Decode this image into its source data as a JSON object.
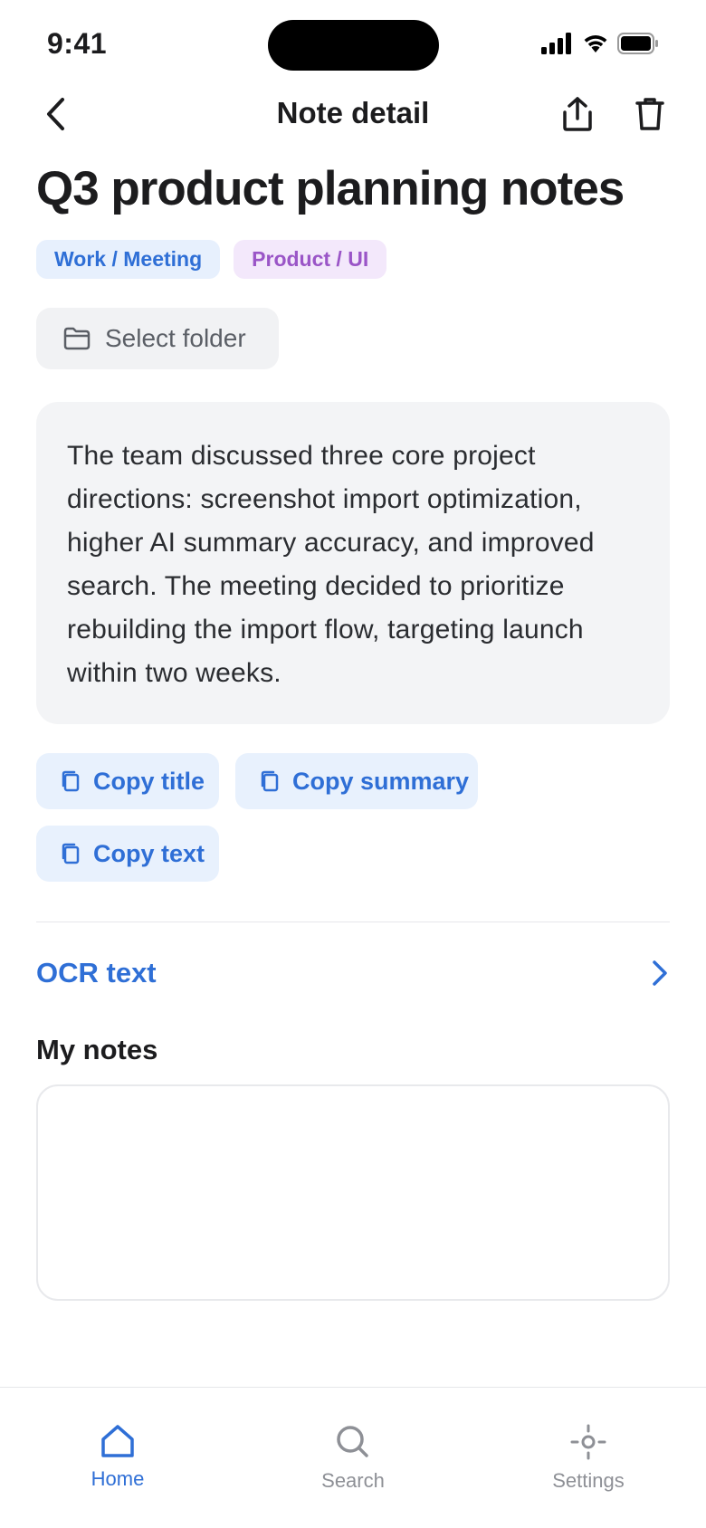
{
  "status_bar": {
    "time": "9:41"
  },
  "nav": {
    "title": "Note detail"
  },
  "note": {
    "title": "Q3 product planning notes",
    "tags": [
      "Work / Meeting",
      "Product / UI"
    ],
    "folder_label": "Select folder",
    "summary": "The team discussed three core project directions: screenshot import optimization, higher AI summary accuracy, and improved search. The meeting decided to prioritize rebuilding the import flow, targeting launch within two weeks."
  },
  "actions": {
    "copy_title": "Copy title",
    "copy_summary": "Copy summary",
    "copy_text": "Copy text"
  },
  "ocr": {
    "label": "OCR text"
  },
  "my_notes": {
    "heading": "My notes",
    "value": ""
  },
  "tabbar": {
    "home": "Home",
    "search": "Search",
    "settings": "Settings"
  },
  "colors": {
    "accent": "#2f6fd6",
    "tag_blue_bg": "#e7f0fd",
    "tag_purple_bg": "#f3e8fb",
    "tag_purple_text": "#9a55c7",
    "card_bg": "#f3f4f6"
  },
  "icons": [
    "back-chevron-icon",
    "share-icon",
    "trash-icon",
    "folder-icon",
    "copy-icon",
    "chevron-right-icon",
    "home-icon",
    "search-icon",
    "settings-icon"
  ]
}
